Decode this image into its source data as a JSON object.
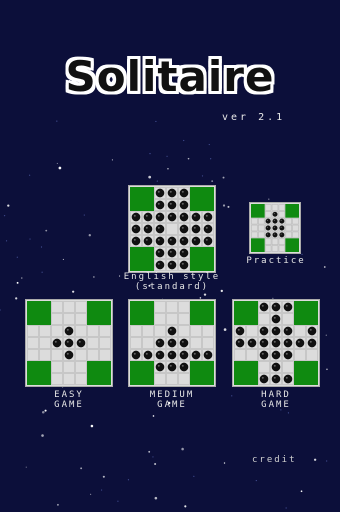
{
  "app": {
    "title": "Solitaire",
    "version": "ver 2.1"
  },
  "menu": {
    "english": {
      "label_line1": "English style",
      "label_line2": "(standard)"
    },
    "practice": {
      "label": "Practice"
    },
    "easy": {
      "label_line1": "EASY",
      "label_line2": "GAME"
    },
    "medium": {
      "label_line1": "MEDIUM",
      "label_line2": "GAME"
    },
    "hard": {
      "label_line1": "HARD",
      "label_line2": "GAME"
    },
    "credit": "credit"
  },
  "boards": {
    "english": [
      "  OOO  ",
      "  OOO  ",
      "OOOOOOO",
      "OOO.OOO",
      "OOOOOOO",
      "  OOO  ",
      "  OOO  "
    ],
    "practice": [
      "  ...  ",
      "  .O.  ",
      "..OOO..",
      "..OOO..",
      "..OOO..",
      "  ...  ",
      "  ...  "
    ],
    "easy": [
      "  ...  ",
      "  ...  ",
      "...O...",
      "..OOO..",
      "...O...",
      "  ...  ",
      "  ...  "
    ],
    "medium": [
      "  ...  ",
      "  ...  ",
      "...O...",
      "..OOO..",
      "OOOOOOO",
      "  OOO  ",
      "  ...  "
    ],
    "hard": [
      "  OOO  ",
      "  .O.  ",
      "O.OOO.O",
      "OOOOOOO",
      "..OOO..",
      "  .O.  ",
      "  OOO  "
    ]
  },
  "colors": {
    "background": "#0c0f3a",
    "board_corner": "#0f8a10",
    "board_cell": "#dcdcdc",
    "peg": "#111111"
  }
}
